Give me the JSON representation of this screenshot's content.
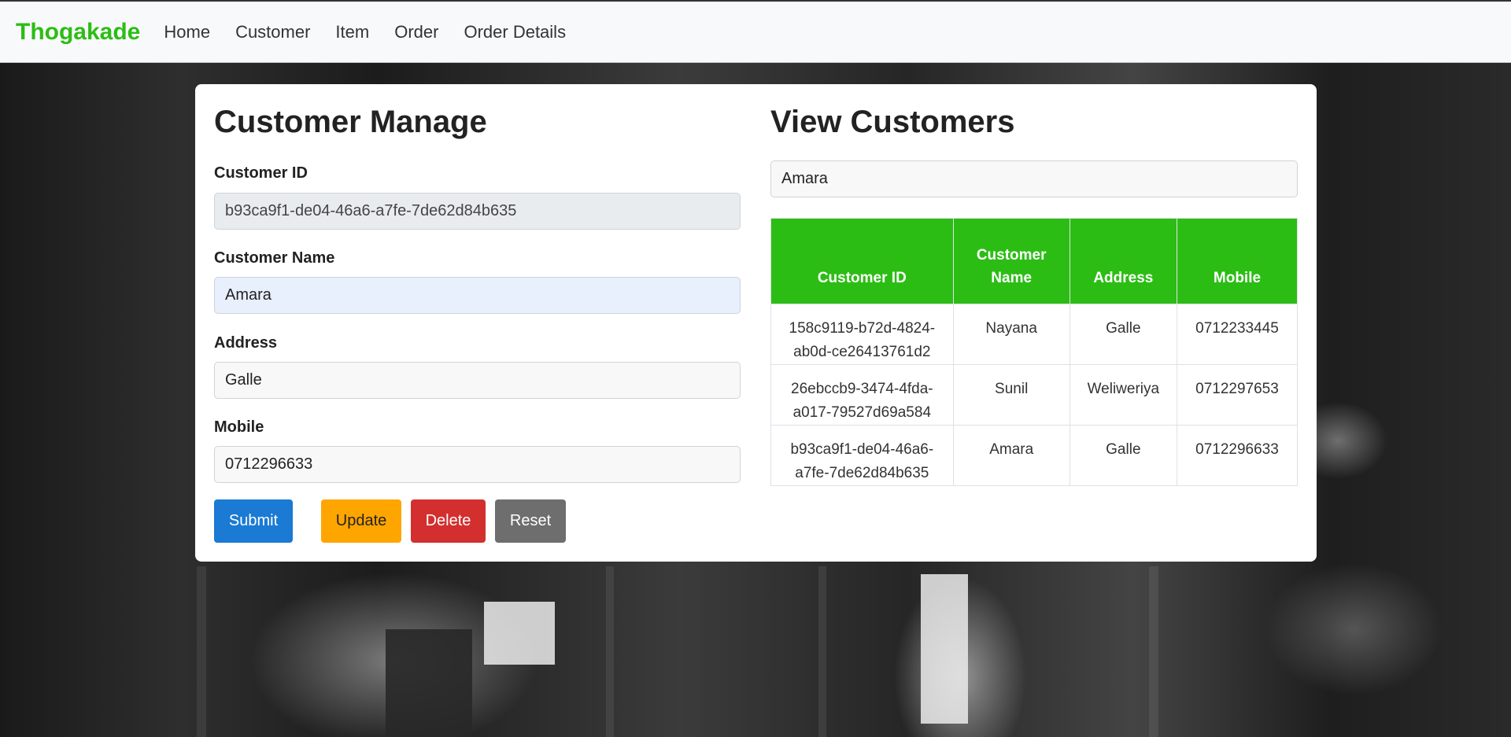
{
  "nav": {
    "brand": "Thogakade",
    "links": [
      "Home",
      "Customer",
      "Item",
      "Order",
      "Order Details"
    ]
  },
  "form": {
    "title": "Customer Manage",
    "fields": [
      {
        "label": "Customer ID",
        "value": "b93ca9f1-de04-46a6-a7fe-7de62d84b635"
      },
      {
        "label": "Customer Name",
        "value": "Amara"
      },
      {
        "label": "Address",
        "value": "Galle"
      },
      {
        "label": "Mobile",
        "value": "0712296633"
      }
    ],
    "buttons": {
      "submit": "Submit",
      "update": "Update",
      "delete": "Delete",
      "reset": "Reset"
    }
  },
  "view": {
    "title": "View Customers",
    "search_value": "Amara",
    "columns": [
      "Customer ID",
      "Customer Name",
      "Address",
      "Mobile"
    ],
    "rows": [
      [
        "158c9119-b72d-4824-ab0d-ce26413761d2",
        "Nayana",
        "Galle",
        "0712233445"
      ],
      [
        "26ebccb9-3474-4fda-a017-79527d69a584",
        "Sunil",
        "Weliweriya",
        "0712297653"
      ],
      [
        "b93ca9f1-de04-46a6-a7fe-7de62d84b635",
        "Amara",
        "Galle",
        "0712296633"
      ]
    ]
  },
  "colors": {
    "brand": "#2cbd15",
    "submit": "#1a7ad4",
    "update": "#ffa500",
    "delete": "#d32f2f",
    "reset": "#6e6e6e"
  }
}
